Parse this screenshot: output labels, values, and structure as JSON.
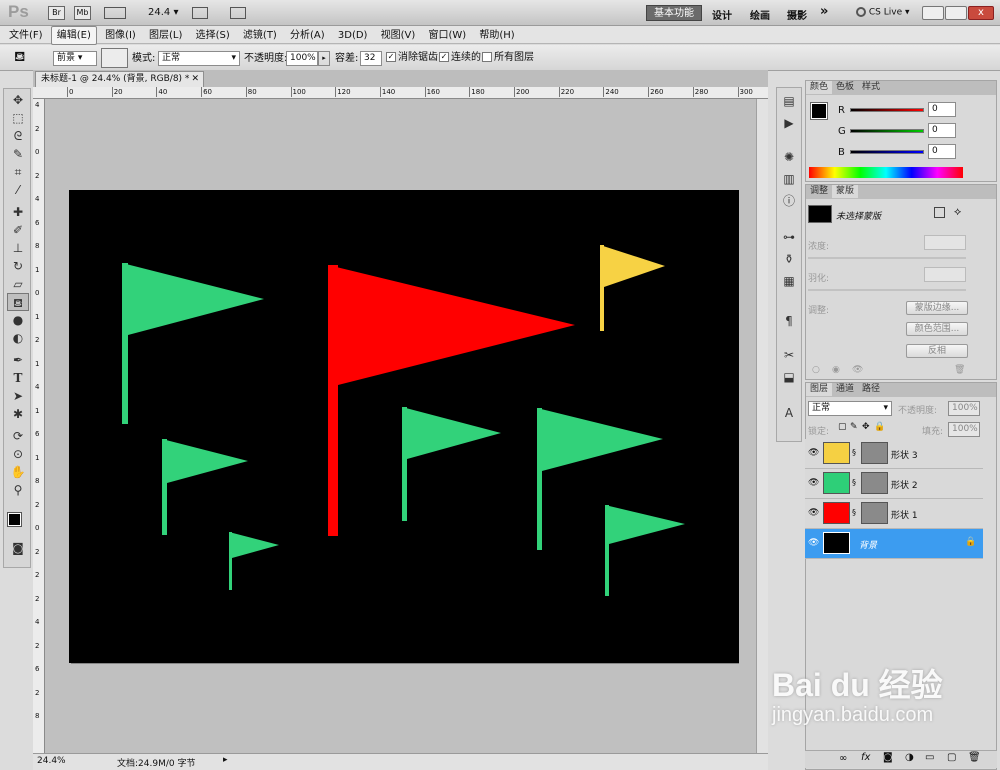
{
  "app": {
    "logo": "Ps",
    "zoom_select": "24.4",
    "workspaces": [
      "基本功能",
      "设计",
      "绘画",
      "摄影"
    ],
    "more": "»",
    "cs_live": "CS Live"
  },
  "menu": [
    "文件(F)",
    "编辑(E)",
    "图像(I)",
    "图层(L)",
    "选择(S)",
    "滤镜(T)",
    "分析(A)",
    "3D(D)",
    "视图(V)",
    "窗口(W)",
    "帮助(H)"
  ],
  "options": {
    "fill_source": "前景",
    "mode_label": "模式:",
    "mode_value": "正常",
    "opacity_label": "不透明度:",
    "opacity_value": "100%",
    "tolerance_label": "容差:",
    "tolerance_value": "32",
    "antialias_label": "消除锯齿",
    "contiguous_label": "连续的",
    "all_layers_label": "所有图层"
  },
  "document": {
    "tab_title": "未标题-1 @ 24.4% (背景, RGB/8) *",
    "ruler_h": [
      "0",
      "20",
      "40",
      "60",
      "80",
      "100",
      "120",
      "140",
      "160",
      "180",
      "200",
      "220",
      "240",
      "260",
      "280",
      "300"
    ],
    "ruler_v": [
      "4",
      "2",
      "0",
      "2",
      "4",
      "6",
      "8",
      "1",
      "0",
      "1",
      "2",
      "1",
      "4",
      "1",
      "6",
      "1",
      "8",
      "2",
      "0",
      "2",
      "2",
      "2",
      "4",
      "2",
      "6",
      "2",
      "8"
    ],
    "status_zoom": "24.4%",
    "status_doc": "文档:24.9M/0 字节"
  },
  "color_panel": {
    "tabs": [
      "颜色",
      "色板",
      "样式"
    ],
    "r_label": "R",
    "r_value": "0",
    "g_label": "G",
    "g_value": "0",
    "b_label": "B",
    "b_value": "0"
  },
  "mask_panel": {
    "tabs": [
      "调整",
      "蒙版"
    ],
    "status": "未选择蒙版",
    "density_label": "浓度:",
    "feather_label": "羽化:",
    "refine_label": "调整:",
    "btn_edge": "蒙版边缘...",
    "btn_color_range": "颜色范围...",
    "btn_invert": "反相"
  },
  "layers_panel": {
    "tabs": [
      "图层",
      "通道",
      "路径"
    ],
    "blend_mode": "正常",
    "opacity_label": "不透明度:",
    "opacity_value": "100%",
    "lock_label": "锁定:",
    "fill_label": "填充:",
    "fill_value": "100%",
    "layers": [
      {
        "name": "形状 3",
        "color": "#f5d043"
      },
      {
        "name": "形状 2",
        "color": "#2ecf78"
      },
      {
        "name": "形状 1",
        "color": "#ff0000"
      },
      {
        "name": "背景",
        "color": "#000000"
      }
    ]
  },
  "canvas": {
    "background": "#000000",
    "flag_colors": {
      "green": "#32d27a",
      "red": "#ff0000",
      "yellow": "#f7d244"
    }
  },
  "watermark": {
    "text": "Bai du 经验",
    "sub": "jingyan.baidu.com"
  }
}
